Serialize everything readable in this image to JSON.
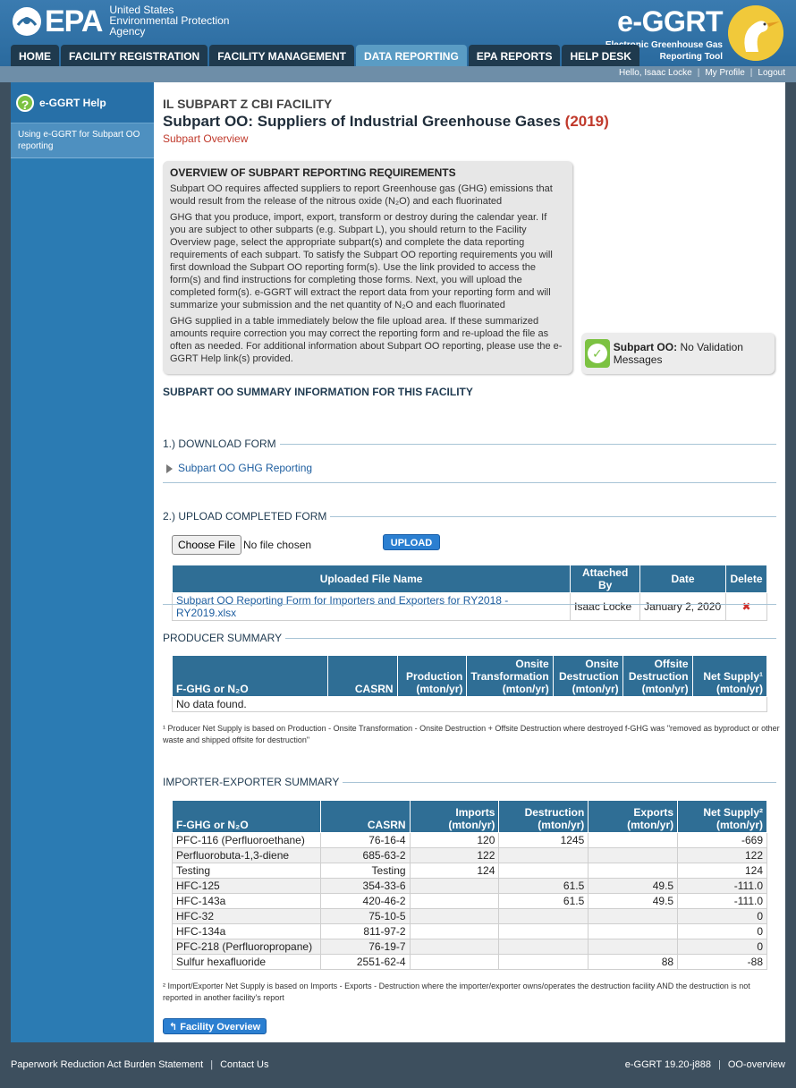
{
  "header": {
    "epa_word": "EPA",
    "agency_line1": "United States",
    "agency_line2": "Environmental Protection",
    "agency_line3": "Agency",
    "app_title": "e-GGRT",
    "app_sub_line1": "Electronic Greenhouse Gas",
    "app_sub_line2": "Reporting Tool"
  },
  "nav": {
    "tabs": [
      "HOME",
      "FACILITY REGISTRATION",
      "FACILITY MANAGEMENT",
      "DATA REPORTING",
      "EPA REPORTS",
      "HELP DESK"
    ],
    "active": "DATA REPORTING"
  },
  "userbar": {
    "greeting": "Hello, Isaac Locke",
    "my_profile": "My Profile",
    "logout": "Logout"
  },
  "sidebar": {
    "help_label": "e-GGRT Help",
    "help_icon": "?",
    "link": "Using e-GGRT for Subpart OO reporting"
  },
  "main": {
    "facility_name": "IL SUBPART Z CBI FACILITY",
    "title": "Subpart OO: Suppliers of Industrial Greenhouse Gases",
    "year": "(2019)",
    "subtitle": "Subpart Overview"
  },
  "overview": {
    "title": "OVERVIEW OF SUBPART REPORTING REQUIREMENTS",
    "para1": "Subpart OO requires affected suppliers to report Greenhouse gas (GHG) emissions that would result from the release of the nitrous oxide (N₂O) and each fluorinated",
    "para2": "GHG that you produce, import, export, transform or destroy during the calendar year. If you are subject to other subparts (e.g. Subpart L), you should return to the Facility Overview page, select the appropriate subpart(s) and complete the data reporting requirements of each subpart. To satisfy the Subpart OO reporting requirements you will first download the Subpart OO reporting form(s). Use the link provided to access the form(s) and find instructions for completing those forms. Next, you will upload the completed form(s). e-GGRT will extract the report data from your reporting form and will summarize your submission and the net quantity of N₂O and each fluorinated",
    "para3": "GHG supplied in a table immediately below the file upload area. If these summarized amounts require correction you may correct the reporting form and re-upload the file as often as needed. For additional information about Subpart OO reporting, please use the e-GGRT Help link(s) provided."
  },
  "validation": {
    "label": "Subpart OO:",
    "message": "No Validation Messages"
  },
  "summary_heading": "SUBPART OO SUMMARY INFORMATION FOR THIS FACILITY",
  "download": {
    "heading": "1.) DOWNLOAD FORM",
    "link": "Subpart OO GHG Reporting"
  },
  "upload": {
    "heading": "2.) UPLOAD COMPLETED FORM",
    "choose_label": "Choose File",
    "file_status": "No file chosen",
    "upload_label": "UPLOAD",
    "columns": [
      "Uploaded File Name",
      "Attached By",
      "Date",
      "Delete"
    ],
    "rows": [
      {
        "file": "Subpart OO Reporting Form for Importers and Exporters for RY2018 - RY2019.xlsx",
        "by": "Isaac Locke",
        "date": "January 2, 2020",
        "delete": "✖"
      }
    ]
  },
  "producer": {
    "heading": "PRODUCER SUMMARY",
    "columns": [
      "F-GHG or N₂O",
      "CASRN",
      "Production (mton/yr)",
      "Onsite Transformation (mton/yr)",
      "Onsite Destruction (mton/yr)",
      "Offsite Destruction (mton/yr)",
      "Net Supply¹ (mton/yr)"
    ],
    "empty": "No data found.",
    "footnote": "¹ Producer Net Supply is based on Production - Onsite Transformation - Onsite Destruction + Offsite Destruction where destroyed f-GHG was \"removed as byproduct or other waste and shipped offsite for destruction\""
  },
  "importer": {
    "heading": "IMPORTER-EXPORTER SUMMARY",
    "columns": [
      "F-GHG or N₂O",
      "CASRN",
      "Imports (mton/yr)",
      "Destruction (mton/yr)",
      "Exports (mton/yr)",
      "Net Supply² (mton/yr)"
    ],
    "rows": [
      [
        "PFC-116 (Perfluoroethane)",
        "76-16-4",
        "120",
        "1245",
        "",
        "-669"
      ],
      [
        "Perfluorobuta-1,3-diene",
        "685-63-2",
        "122",
        "",
        "",
        "122"
      ],
      [
        "Testing",
        "Testing",
        "124",
        "",
        "",
        "124"
      ],
      [
        "HFC-125",
        "354-33-6",
        "",
        "61.5",
        "49.5",
        "-111.0"
      ],
      [
        "HFC-143a",
        "420-46-2",
        "",
        "61.5",
        "49.5",
        "-111.0"
      ],
      [
        "HFC-32",
        "75-10-5",
        "",
        "",
        "",
        "0"
      ],
      [
        "HFC-134a",
        "811-97-2",
        "",
        "",
        "",
        "0"
      ],
      [
        "PFC-218 (Perfluoropropane)",
        "76-19-7",
        "",
        "",
        "",
        "0"
      ],
      [
        "Sulfur hexafluoride",
        "2551-62-4",
        "",
        "",
        "88",
        "-88"
      ]
    ],
    "footnote": "² Import/Exporter Net Supply is based on Imports - Exports - Destruction where the importer/exporter owns/operates the destruction facility AND the destruction is not reported in another facility's report"
  },
  "facility_overview_label": "Facility Overview",
  "footer": {
    "paperwork": "Paperwork Reduction Act Burden Statement",
    "contact": "Contact Us",
    "version": "e-GGRT 19.20-j888",
    "page": "OO-overview"
  }
}
